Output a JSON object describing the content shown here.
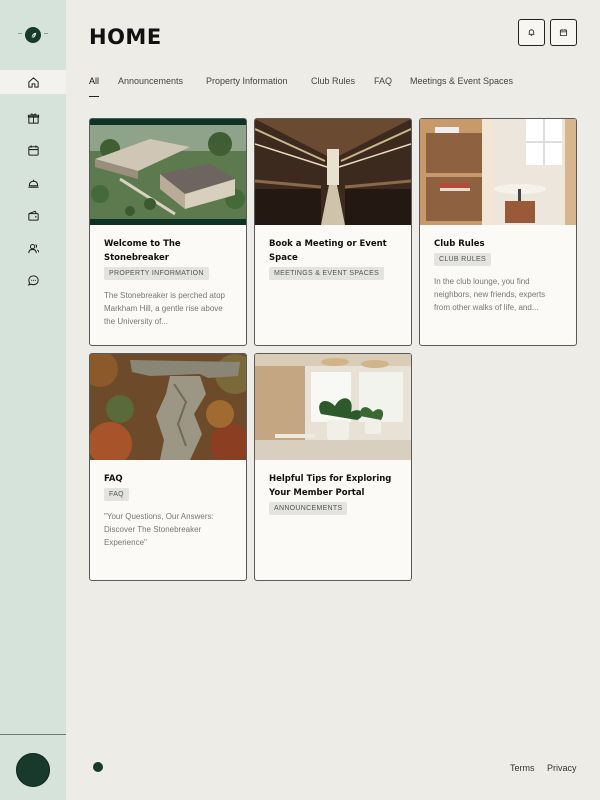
{
  "page": {
    "title": "HOME"
  },
  "sidebar": {
    "items": [
      {
        "icon": "home-icon",
        "active": true
      },
      {
        "icon": "gift-icon"
      },
      {
        "icon": "calendar-icon"
      },
      {
        "icon": "dining-bell-icon"
      },
      {
        "icon": "wallet-icon"
      },
      {
        "icon": "members-icon"
      },
      {
        "icon": "chat-icon"
      }
    ]
  },
  "header": {
    "buttons": [
      {
        "icon": "bell-icon"
      },
      {
        "icon": "calendar-icon"
      }
    ]
  },
  "tabs": [
    {
      "label": "All",
      "active": true
    },
    {
      "label": "Announcements"
    },
    {
      "label": "Property Information"
    },
    {
      "label": "Club Rules"
    },
    {
      "label": "FAQ"
    },
    {
      "label": "Meetings & Event Spaces"
    }
  ],
  "cards": [
    {
      "title": "Welcome to The Stonebreaker",
      "tag": "PROPERTY INFORMATION",
      "excerpt": "The Stonebreaker is perched atop Markham Hill, a gentle rise above the University of..."
    },
    {
      "title": "Book a Meeting or Event Space",
      "tag": "MEETINGS & EVENT SPACES",
      "excerpt": ""
    },
    {
      "title": "Club Rules",
      "tag": "CLUB RULES",
      "excerpt": "In the club lounge, you find neighbors, new friends, experts from other walks of life, and..."
    },
    {
      "title": "FAQ",
      "tag": "FAQ",
      "excerpt": "\"Your Questions, Our Answers: Discover The Stonebreaker Experience\""
    },
    {
      "title": "Helpful Tips for Exploring Your Member Portal",
      "tag": "ANNOUNCEMENTS",
      "excerpt": ""
    }
  ],
  "footer": {
    "terms": "Terms",
    "privacy": "Privacy"
  },
  "colors": {
    "sidebar": "#d6e3da",
    "brand": "#173a2c",
    "background": "#eeece6",
    "card": "#fbfaf6"
  }
}
